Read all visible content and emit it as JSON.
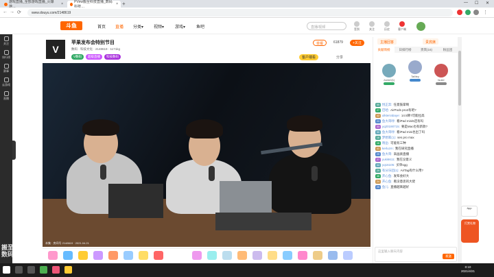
{
  "browser": {
    "tabs": [
      {
        "label": "游戏直播_全部游戏直播_火爆游…",
        "active": false
      },
      {
        "label": "PVew搬至科技直播_数码科技…",
        "active": true
      }
    ],
    "new_tab": "+",
    "url": "www.douyu.com/2148619"
  },
  "site": {
    "logo": "斗鱼",
    "nav": [
      "首页",
      "直播",
      "分类▾",
      "视频▾",
      "游戏▾",
      "鱼吧"
    ],
    "active_nav": "直播",
    "search_placeholder": "直播/视频",
    "header_icons": [
      "签到",
      "关注",
      "历史",
      "客户端",
      "创作"
    ]
  },
  "sidebar": {
    "items": [
      "关注",
      "排行榜",
      "赛事",
      "云游戏",
      "直播"
    ]
  },
  "room": {
    "logo": "V",
    "title": "苹果发布会特别节目",
    "meta": "数码 · 科技文化 · 2148619 · 1171kg",
    "tags": [
      "V数码",
      "超级直播",
      "科技数码"
    ],
    "follow_label": "+关注",
    "follow_count": "61879",
    "report_label": "举报",
    "share_label": "分享",
    "client_label": "客户端看"
  },
  "video": {
    "footer": "本集 · 房间号 2148619 · 2021.04.21"
  },
  "right_panel": {
    "tabs": [
      "主播回答",
      "贵宾席"
    ],
    "rank_tabs": [
      "贡献周榜",
      "日排行榜",
      "贵宾(16)",
      "粉丝团"
    ],
    "podium": [
      {
        "name": "Jucto0(1)",
        "color": "#7ab"
      },
      {
        "name": "TaMey",
        "color": "#9ac"
      },
      {
        "name": "tsukir",
        "color": "#c55"
      }
    ],
    "chat": [
      {
        "level": "55",
        "user": "悦正奔:",
        "text": "任意鼓掌啊"
      },
      {
        "level": "27",
        "user": "巴哈:",
        "text": "AirPods pro2有吧?"
      },
      {
        "level": "42",
        "user": "ulkterrabaye:",
        "text": "14.5降7可能拉高"
      },
      {
        "level": "23",
        "user": "鱼大哥呼:",
        "text": "看iPad mini5还有吗"
      },
      {
        "level": "33",
        "user": "yq20190715:",
        "text": "要是Mac也有新款?"
      },
      {
        "level": "30",
        "user": "鱼大哥呼:",
        "text": "看iPad mini也出了吗"
      },
      {
        "level": "18",
        "user": "梦想家(1):",
        "text": "ses pro max"
      },
      {
        "level": "16",
        "user": "晓岳:",
        "text": "可能有三种"
      },
      {
        "level": "41",
        "user": "kerluzm:",
        "text": "我在研究直播"
      },
      {
        "level": "25",
        "user": "鱼大哥:",
        "text": "高画质直播"
      },
      {
        "level": "27",
        "user": "yuki6611:",
        "text": "我在没意义"
      },
      {
        "level": "44",
        "user": "yq16105:",
        "text": "买单sgg"
      },
      {
        "level": "29",
        "user": "有分乐团(1):",
        "text": "AirTag有什么用?"
      },
      {
        "level": "46",
        "user": "开心鱼:",
        "text": "发布会好大"
      },
      {
        "level": "24",
        "user": "开心鱼:",
        "text": "看没意思的大佬"
      },
      {
        "level": "25",
        "user": "鱼儿:",
        "text": "直播越来越好"
      }
    ],
    "input_placeholder": "这里输入聊天内容",
    "send_label": "发送"
  },
  "float": {
    "fab1": "App",
    "fab2": "打赏礼物"
  },
  "watermark": "搬至\n数码科技",
  "taskbar": {
    "time": "0:10",
    "date": "2021/4/21"
  }
}
